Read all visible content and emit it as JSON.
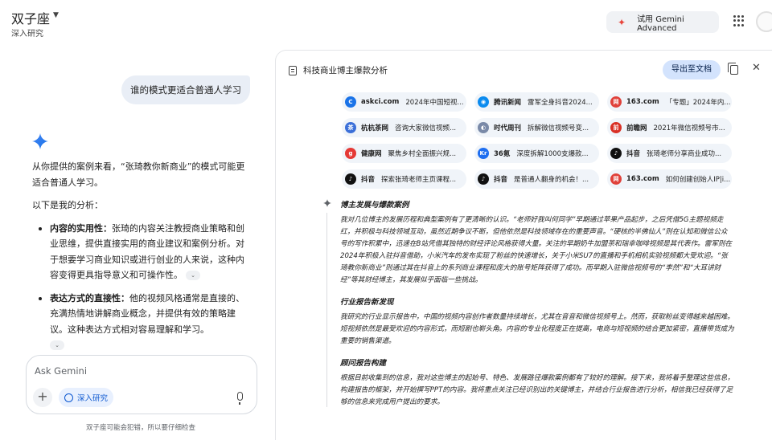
{
  "header": {
    "app_title": "双子座",
    "app_subtitle": "深入研究",
    "try_advanced": "试用 Gemini Advanced"
  },
  "chat": {
    "user_message": "谁的模式更适合普通人学习",
    "answer_intro": "从你提供的案例来看，“张琦教你新商业”的模式可能更适合普通人学习。",
    "analysis_heading": "以下是我的分析：",
    "points": [
      {
        "title": "内容的实用性：",
        "body": "张琦的内容关注教授商业策略和创业思维，提供直接实用的商业建议和案例分析。对于想要学习商业知识或进行创业的人来说，这种内容变得更具指导意义和可操作性。"
      },
      {
        "title": "表达方式的直接性：",
        "body": "他的视频风格通常是直接的、充满热情地讲解商业概念，并提供有效的策略建议。这种表达方式相对容易理解和学习。"
      }
    ],
    "composer_placeholder": "Ask Gemini",
    "deep_research_label": "深入研究",
    "disclaimer": "双子座可能会犯错，所以要仔细检查"
  },
  "panel": {
    "title": "科技商业博主爆款分析",
    "export_label": "导出至文档",
    "sources": [
      {
        "site": "askci.com",
        "title": "2024年中国短视...",
        "icon_color": "#1a73e8",
        "icon_glyph": "C"
      },
      {
        "site": "腾讯新闻",
        "title": "雷军全身抖音2024...",
        "icon_color": "#0b8bef",
        "icon_glyph": "◉"
      },
      {
        "site": "163.com",
        "title": "「专题」2024年内...",
        "icon_color": "#e0413a",
        "icon_glyph": "网"
      },
      {
        "site": "杭杭茶网",
        "title": "咨询大家微信视频...",
        "icon_color": "#3b6fd8",
        "icon_glyph": "茶"
      },
      {
        "site": "时代周刊",
        "title": "拆解微信视频号变...",
        "icon_color": "#7a8aa8",
        "icon_glyph": "◐"
      },
      {
        "site": "前瞻网",
        "title": "2021年微信视频号市...",
        "icon_color": "#d93025",
        "icon_glyph": "前"
      },
      {
        "site": "健康网",
        "title": "聚焦乡村全面振兴规...",
        "icon_color": "#e53935",
        "icon_glyph": "g"
      },
      {
        "site": "36氪",
        "title": "深度拆解1000支爆款...",
        "icon_color": "#1e6ef0",
        "icon_glyph": "Kr"
      },
      {
        "site": "抖音",
        "title": "张琦老师分享商业成功...",
        "icon_color": "#111111",
        "icon_glyph": "♪"
      },
      {
        "site": "抖音",
        "title": "探索张琦老师主页课程...",
        "icon_color": "#111111",
        "icon_glyph": "♪"
      },
      {
        "site": "抖音",
        "title": "是普通人翻身的机会！...",
        "icon_color": "#111111",
        "icon_glyph": "♪"
      },
      {
        "site": "163.com",
        "title": "如何创建创始人IP|i...",
        "icon_color": "#e0413a",
        "icon_glyph": "网"
      }
    ],
    "sections": [
      {
        "heading": "博主发展与爆款案例",
        "body": "我对几位博主的发展历程和典型案例有了更清晰的认识。“老师好我叫何同学”早期通过苹果产品起步，之后凭借5G主题视频走红，并积极与科技领域互动，虽然近期争议不断，但他依然是科技领域存在的重要声音。“硬核的半佛仙人”则在认知和微信公众号的写作积累中，迅速在B站凭借其独特的财经评论风格获得大量。关注的早期奶牛加盟茶和瑞幸咖啡视频是其代表作。雷军则在2024年积极入驻抖音借助，小米汽车的发布实现了粉丝的快速增长，关于小米SU7的直播和手机相机实验视频都大受欢迎。“张琦教你新商业”则通过其在抖音上的系列商业课程和庞大的账号矩阵获得了成功。而早期入驻微信视频号的“李然”和“大耳讲财经”等其财经博主，其发展似乎面临一些挑战。"
      },
      {
        "heading": "行业报告新发现",
        "body": "我研究的行业显示报告中，中国的视频内容创作者数量持续增长，尤其在音音和微信视频号上。然而，获取粉丝变得越来越困难。短视频依然是最受欢迎的内容形式，而短剧也崭头角。内容的专业化程度正在提高，电商与短视频的结合更加紧密，直播带货成为重要的销售渠道。"
      },
      {
        "heading": "顾问报告构建",
        "body": "根据目前收集到的信息，我对这些博主的起始号、特色、发展路径爆款案例都有了较好的理解。接下来，我将着手整理这些信息，构建报告的框架，并开始撰写PPT的内容。我将重点关注已经识别出的关键博主，并结合行业报告进行分析，相信我已经获得了足够的信息来完成用户提出的要求。"
      }
    ]
  }
}
